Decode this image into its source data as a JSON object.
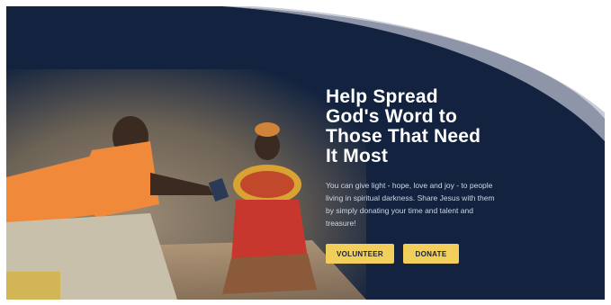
{
  "hero": {
    "title_lines": [
      "Help Spread",
      "God's Word to",
      "Those That Need",
      "It Most"
    ],
    "body_lines": [
      "You can give light - hope, love and joy - to people",
      "living in spiritual darkness. Share Jesus with them",
      "by simply donating your time and talent and",
      "treasure!"
    ],
    "volunteer_label": "VOLUNTEER",
    "donate_label": "DONATE"
  },
  "colors": {
    "background": "#13233f",
    "button": "#f1cf5a",
    "curve": "#8e95a8"
  }
}
